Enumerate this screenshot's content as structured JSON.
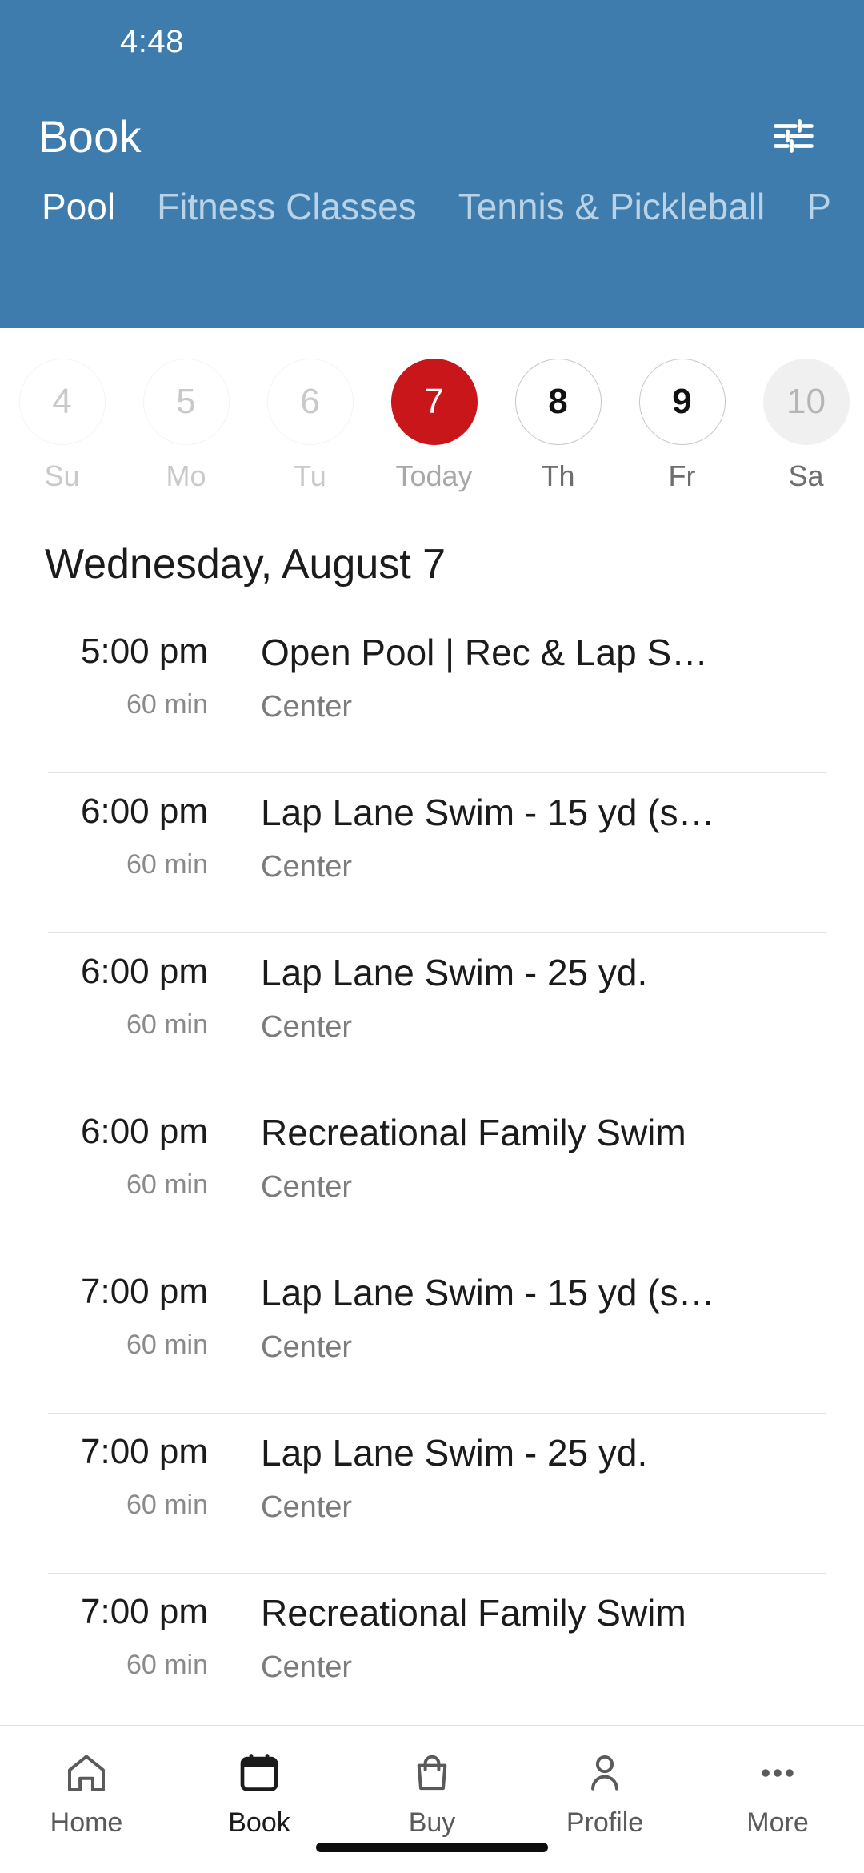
{
  "status_bar": {
    "time": "4:48"
  },
  "header": {
    "title": "Book",
    "background_color": "#3E7CAD",
    "filter_icon": "tune-filter-icon",
    "tabs": [
      {
        "label": "Pool",
        "active": true
      },
      {
        "label": "Fitness Classes",
        "active": false
      },
      {
        "label": "Tennis & Pickleball",
        "active": false
      },
      {
        "label": "P",
        "active": false
      }
    ]
  },
  "date_strip": {
    "selected_color": "#C8161A",
    "days": [
      {
        "number": "4",
        "weekday": "Su",
        "state": "past"
      },
      {
        "number": "5",
        "weekday": "Mo",
        "state": "past"
      },
      {
        "number": "6",
        "weekday": "Tu",
        "state": "past"
      },
      {
        "number": "7",
        "weekday": "Today",
        "state": "today"
      },
      {
        "number": "8",
        "weekday": "Th",
        "state": "avail"
      },
      {
        "number": "9",
        "weekday": "Fr",
        "state": "avail"
      },
      {
        "number": "10",
        "weekday": "Sa",
        "state": "filled"
      }
    ]
  },
  "day_heading": "Wednesday, August 7",
  "schedule": [
    {
      "time": "5:00 pm",
      "duration": "60 min",
      "title": "Open Pool | Rec & Lap S…",
      "location": "Center"
    },
    {
      "time": "6:00 pm",
      "duration": "60 min",
      "title": "Lap Lane Swim - 15 yd (s…",
      "location": "Center"
    },
    {
      "time": "6:00 pm",
      "duration": "60 min",
      "title": "Lap Lane Swim - 25 yd.",
      "location": "Center"
    },
    {
      "time": "6:00 pm",
      "duration": "60 min",
      "title": "Recreational Family Swim",
      "location": "Center"
    },
    {
      "time": "7:00 pm",
      "duration": "60 min",
      "title": "Lap Lane Swim - 15 yd (s…",
      "location": "Center"
    },
    {
      "time": "7:00 pm",
      "duration": "60 min",
      "title": "Lap Lane Swim - 25 yd.",
      "location": "Center"
    },
    {
      "time": "7:00 pm",
      "duration": "60 min",
      "title": "Recreational Family Swim",
      "location": "Center"
    }
  ],
  "bottom_nav": {
    "items": [
      {
        "label": "Home",
        "icon": "home-icon",
        "active": false
      },
      {
        "label": "Book",
        "icon": "calendar-icon",
        "active": true
      },
      {
        "label": "Buy",
        "icon": "bag-icon",
        "active": false
      },
      {
        "label": "Profile",
        "icon": "person-icon",
        "active": false
      },
      {
        "label": "More",
        "icon": "ellipsis-icon",
        "active": false
      }
    ]
  }
}
